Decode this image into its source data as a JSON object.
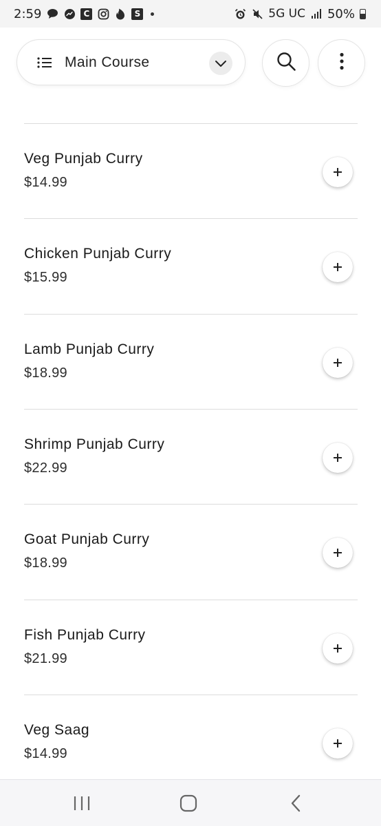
{
  "status_bar": {
    "time": "2:59",
    "notification_icons": [
      "chat-bubble-icon",
      "messenger-icon",
      "c-app-icon",
      "instagram-icon",
      "tinder-icon",
      "s-app-icon"
    ],
    "c_app_letter": "C",
    "s_app_letter": "S",
    "network": "5G UC",
    "battery": "50%"
  },
  "header": {
    "category_label": "Main Course",
    "category_icon": "list-icon",
    "dropdown_icon": "chevron-down-icon",
    "search_icon": "search-icon",
    "more_icon": "more-vertical-icon"
  },
  "menu": {
    "add_icon": "plus-icon",
    "items": [
      {
        "name": "Veg Punjab Curry",
        "price": "$14.99"
      },
      {
        "name": "Chicken Punjab Curry",
        "price": "$15.99"
      },
      {
        "name": "Lamb Punjab Curry",
        "price": "$18.99"
      },
      {
        "name": "Shrimp Punjab Curry",
        "price": "$22.99"
      },
      {
        "name": "Goat Punjab Curry",
        "price": "$18.99"
      },
      {
        "name": "Fish Punjab Curry",
        "price": "$21.99"
      },
      {
        "name": "Veg Saag",
        "price": "$14.99"
      }
    ]
  },
  "nav_bar": {
    "recents_icon": "recents-icon",
    "home_icon": "home-icon",
    "back_icon": "back-icon"
  }
}
